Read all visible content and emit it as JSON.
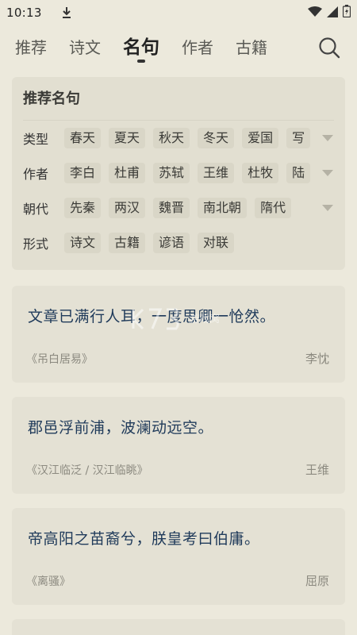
{
  "status": {
    "time": "10:13"
  },
  "nav": {
    "tabs": [
      {
        "label": "推荐",
        "active": false
      },
      {
        "label": "诗文",
        "active": false
      },
      {
        "label": "名句",
        "active": true
      },
      {
        "label": "作者",
        "active": false
      },
      {
        "label": "古籍",
        "active": false
      }
    ]
  },
  "filter": {
    "title": "推荐名句",
    "rows": [
      {
        "label": "类型",
        "chips": [
          "春天",
          "夏天",
          "秋天",
          "冬天",
          "爱国",
          "写"
        ]
      },
      {
        "label": "作者",
        "chips": [
          "李白",
          "杜甫",
          "苏轼",
          "王维",
          "杜牧",
          "陆"
        ]
      },
      {
        "label": "朝代",
        "chips": [
          "先秦",
          "两汉",
          "魏晋",
          "南北朝",
          "隋代"
        ]
      },
      {
        "label": "形式",
        "chips": [
          "诗文",
          "古籍",
          "谚语",
          "对联"
        ]
      }
    ]
  },
  "quotes": [
    {
      "text": "文章已满行人耳，一度思卿一怆然。",
      "source": "《吊白居易》",
      "author": "李忱"
    },
    {
      "text": "郡邑浮前浦，波澜动远空。",
      "source": "《汉江临泛 / 汉江临眺》",
      "author": "王维"
    },
    {
      "text": "帝高阳之苗裔兮，朕皇考曰伯庸。",
      "source": "《离骚》",
      "author": "屈原"
    }
  ],
  "watermark": {
    "text": "游戏窝"
  },
  "colors": {
    "background": "#ece9dc",
    "card": "#e4e1d4",
    "quote_text": "#1f3a5a",
    "muted": "#8c8a80"
  }
}
